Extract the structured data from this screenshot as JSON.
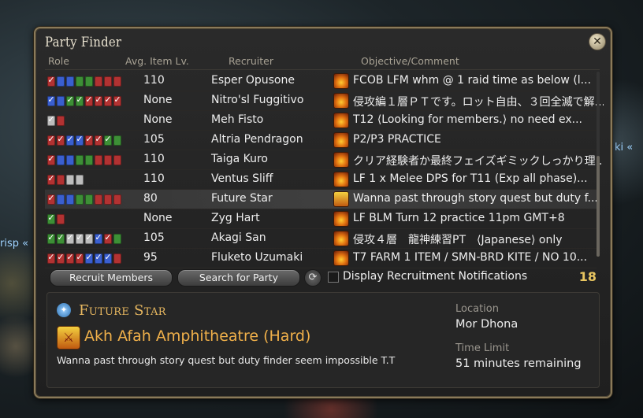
{
  "window": {
    "title": "Party Finder",
    "close_icon": "close-icon"
  },
  "columns": {
    "role": "Role",
    "ilvl": "Avg. Item Lv.",
    "recruiter": "Recruiter",
    "objective": "Objective/Comment"
  },
  "listings": [
    {
      "roles": [
        "dps-filled",
        "tank",
        "tank",
        "healer",
        "healer",
        "dps",
        "dps",
        "dps"
      ],
      "ilvl": "110",
      "recruiter": "Esper Opusone",
      "comment": "FCOB LFM whm @ 1  raid time as below (l..."
    },
    {
      "roles": [
        "tank-filled",
        "tank",
        "healer-filled",
        "healer-filled",
        "dps-filled",
        "dps-filled",
        "dps-filled",
        "dps-filled"
      ],
      "ilvl": "None",
      "recruiter": "Nitro'sl Fuggitivo",
      "comment": "侵攻編１層ＰＴです。ロット自由、３回全滅で解..."
    },
    {
      "roles": [
        "any-filled",
        "dps"
      ],
      "ilvl": "None",
      "recruiter": "Meh Fisto",
      "comment": "T12 ⟨Looking for members.⟩ no need ex..."
    },
    {
      "roles": [
        "dps-filled",
        "dps-filled",
        "tank-filled",
        "tank-filled",
        "dps-filled",
        "dps-filled",
        "healer-filled",
        "healer"
      ],
      "ilvl": "105",
      "recruiter": "Altria Pendragon",
      "comment": "P2/P3 PRACTICE"
    },
    {
      "roles": [
        "dps-filled",
        "tank",
        "tank",
        "healer",
        "healer",
        "dps",
        "dps",
        "dps"
      ],
      "ilvl": "110",
      "recruiter": "Taiga Kuro",
      "comment": "クリア経験者か最終フェイズギミックしっかり理..."
    },
    {
      "roles": [
        "dps-filled",
        "dps",
        "any",
        "any"
      ],
      "ilvl": "110",
      "recruiter": "Ventus Sliff",
      "comment": "LF 1 x Melee DPS for T11 (Exp all phase)..."
    },
    {
      "roles": [
        "dps-filled",
        "tank",
        "tank",
        "healer",
        "healer",
        "dps",
        "dps",
        "dps"
      ],
      "ilvl": "80",
      "recruiter": "Future Star",
      "comment": "Wanna past through story quest but duty f...",
      "selected": true
    },
    {
      "roles": [
        "healer-filled",
        "dps"
      ],
      "ilvl": "None",
      "recruiter": "Zyg Hart",
      "comment": "LF  BLM Turn 12 practice 11pm GMT+8"
    },
    {
      "roles": [
        "healer-filled",
        "healer-filled",
        "any-filled",
        "any-filled",
        "any-filled",
        "tank-filled",
        "dps-filled",
        "healer"
      ],
      "ilvl": "105",
      "recruiter": "Akagi San",
      "comment": "侵攻４層　龍神練習PT　⟨Japanese⟩ only"
    },
    {
      "roles": [
        "dps-filled",
        "dps-filled",
        "dps-filled",
        "dps-filled",
        "tank-filled",
        "tank-filled",
        "tank-filled",
        "dps"
      ],
      "ilvl": "95",
      "recruiter": "Fluketo Uzumaki",
      "comment": "T7 FARM 1 ITEM / SMN-BRD KITE / NO 10..."
    }
  ],
  "footer": {
    "recruit_button": "Recruit Members",
    "search_button": "Search for Party",
    "notifications_label": "Display Recruitment Notifications",
    "count": "18"
  },
  "detail": {
    "name": "Future Star",
    "duty": "Akh Afah Amphitheatre (Hard)",
    "comment": "Wanna past through story quest but duty finder seem impossible T.T",
    "location_label": "Location",
    "location": "Mor Dhona",
    "time_label": "Time Limit",
    "time": "51 minutes remaining"
  },
  "background": {
    "left_text": "risp «",
    "right_text": "ki «"
  }
}
